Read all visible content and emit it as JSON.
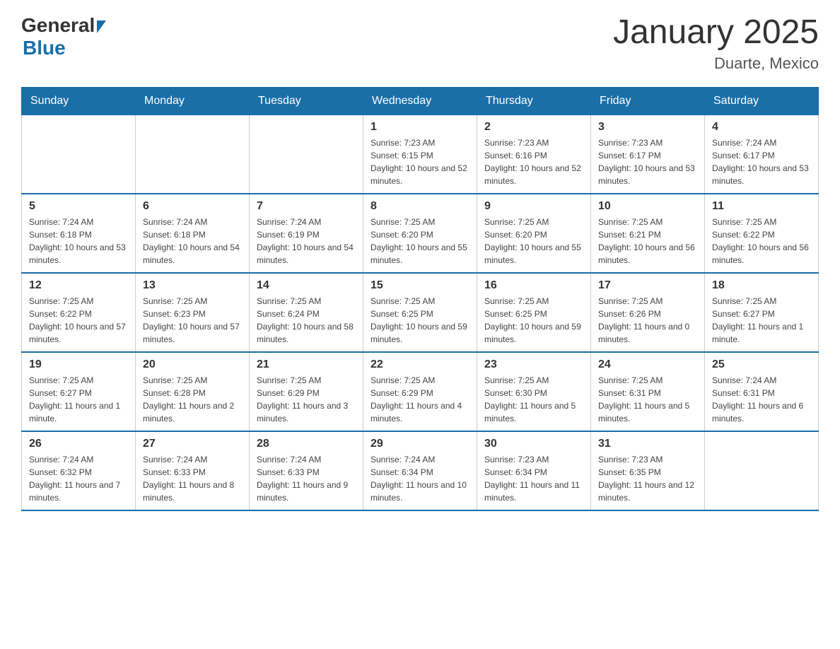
{
  "logo": {
    "general": "General",
    "blue": "Blue"
  },
  "title": "January 2025",
  "location": "Duarte, Mexico",
  "days_of_week": [
    "Sunday",
    "Monday",
    "Tuesday",
    "Wednesday",
    "Thursday",
    "Friday",
    "Saturday"
  ],
  "weeks": [
    [
      {
        "day": "",
        "info": ""
      },
      {
        "day": "",
        "info": ""
      },
      {
        "day": "",
        "info": ""
      },
      {
        "day": "1",
        "info": "Sunrise: 7:23 AM\nSunset: 6:15 PM\nDaylight: 10 hours and 52 minutes."
      },
      {
        "day": "2",
        "info": "Sunrise: 7:23 AM\nSunset: 6:16 PM\nDaylight: 10 hours and 52 minutes."
      },
      {
        "day": "3",
        "info": "Sunrise: 7:23 AM\nSunset: 6:17 PM\nDaylight: 10 hours and 53 minutes."
      },
      {
        "day": "4",
        "info": "Sunrise: 7:24 AM\nSunset: 6:17 PM\nDaylight: 10 hours and 53 minutes."
      }
    ],
    [
      {
        "day": "5",
        "info": "Sunrise: 7:24 AM\nSunset: 6:18 PM\nDaylight: 10 hours and 53 minutes."
      },
      {
        "day": "6",
        "info": "Sunrise: 7:24 AM\nSunset: 6:18 PM\nDaylight: 10 hours and 54 minutes."
      },
      {
        "day": "7",
        "info": "Sunrise: 7:24 AM\nSunset: 6:19 PM\nDaylight: 10 hours and 54 minutes."
      },
      {
        "day": "8",
        "info": "Sunrise: 7:25 AM\nSunset: 6:20 PM\nDaylight: 10 hours and 55 minutes."
      },
      {
        "day": "9",
        "info": "Sunrise: 7:25 AM\nSunset: 6:20 PM\nDaylight: 10 hours and 55 minutes."
      },
      {
        "day": "10",
        "info": "Sunrise: 7:25 AM\nSunset: 6:21 PM\nDaylight: 10 hours and 56 minutes."
      },
      {
        "day": "11",
        "info": "Sunrise: 7:25 AM\nSunset: 6:22 PM\nDaylight: 10 hours and 56 minutes."
      }
    ],
    [
      {
        "day": "12",
        "info": "Sunrise: 7:25 AM\nSunset: 6:22 PM\nDaylight: 10 hours and 57 minutes."
      },
      {
        "day": "13",
        "info": "Sunrise: 7:25 AM\nSunset: 6:23 PM\nDaylight: 10 hours and 57 minutes."
      },
      {
        "day": "14",
        "info": "Sunrise: 7:25 AM\nSunset: 6:24 PM\nDaylight: 10 hours and 58 minutes."
      },
      {
        "day": "15",
        "info": "Sunrise: 7:25 AM\nSunset: 6:25 PM\nDaylight: 10 hours and 59 minutes."
      },
      {
        "day": "16",
        "info": "Sunrise: 7:25 AM\nSunset: 6:25 PM\nDaylight: 10 hours and 59 minutes."
      },
      {
        "day": "17",
        "info": "Sunrise: 7:25 AM\nSunset: 6:26 PM\nDaylight: 11 hours and 0 minutes."
      },
      {
        "day": "18",
        "info": "Sunrise: 7:25 AM\nSunset: 6:27 PM\nDaylight: 11 hours and 1 minute."
      }
    ],
    [
      {
        "day": "19",
        "info": "Sunrise: 7:25 AM\nSunset: 6:27 PM\nDaylight: 11 hours and 1 minute."
      },
      {
        "day": "20",
        "info": "Sunrise: 7:25 AM\nSunset: 6:28 PM\nDaylight: 11 hours and 2 minutes."
      },
      {
        "day": "21",
        "info": "Sunrise: 7:25 AM\nSunset: 6:29 PM\nDaylight: 11 hours and 3 minutes."
      },
      {
        "day": "22",
        "info": "Sunrise: 7:25 AM\nSunset: 6:29 PM\nDaylight: 11 hours and 4 minutes."
      },
      {
        "day": "23",
        "info": "Sunrise: 7:25 AM\nSunset: 6:30 PM\nDaylight: 11 hours and 5 minutes."
      },
      {
        "day": "24",
        "info": "Sunrise: 7:25 AM\nSunset: 6:31 PM\nDaylight: 11 hours and 5 minutes."
      },
      {
        "day": "25",
        "info": "Sunrise: 7:24 AM\nSunset: 6:31 PM\nDaylight: 11 hours and 6 minutes."
      }
    ],
    [
      {
        "day": "26",
        "info": "Sunrise: 7:24 AM\nSunset: 6:32 PM\nDaylight: 11 hours and 7 minutes."
      },
      {
        "day": "27",
        "info": "Sunrise: 7:24 AM\nSunset: 6:33 PM\nDaylight: 11 hours and 8 minutes."
      },
      {
        "day": "28",
        "info": "Sunrise: 7:24 AM\nSunset: 6:33 PM\nDaylight: 11 hours and 9 minutes."
      },
      {
        "day": "29",
        "info": "Sunrise: 7:24 AM\nSunset: 6:34 PM\nDaylight: 11 hours and 10 minutes."
      },
      {
        "day": "30",
        "info": "Sunrise: 7:23 AM\nSunset: 6:34 PM\nDaylight: 11 hours and 11 minutes."
      },
      {
        "day": "31",
        "info": "Sunrise: 7:23 AM\nSunset: 6:35 PM\nDaylight: 11 hours and 12 minutes."
      },
      {
        "day": "",
        "info": ""
      }
    ]
  ]
}
